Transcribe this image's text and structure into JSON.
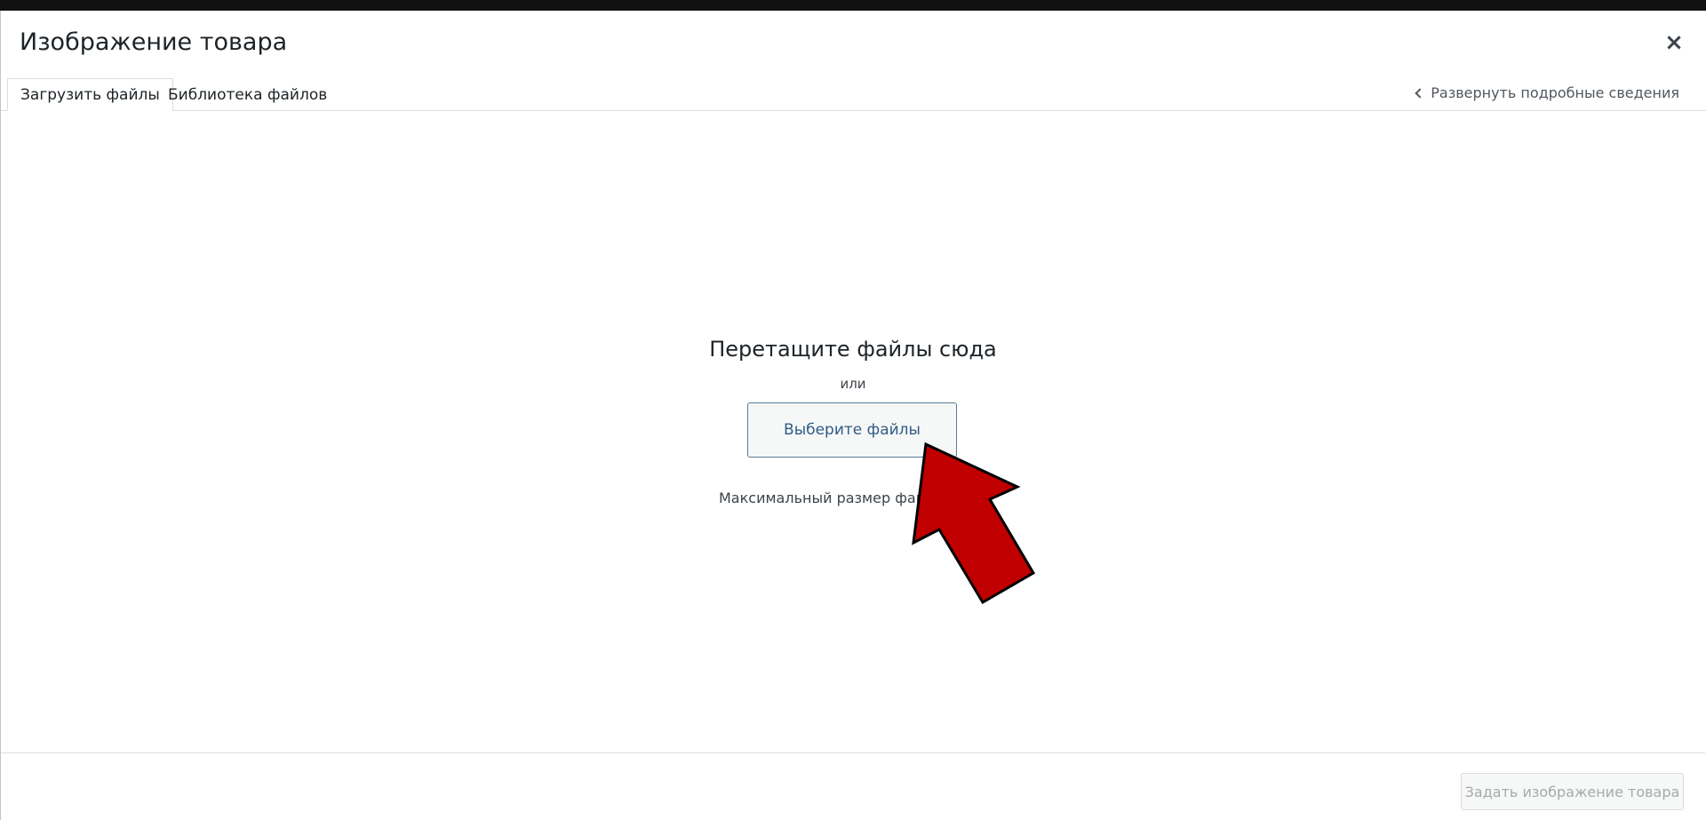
{
  "modal": {
    "title": "Изображение товара",
    "close_label": "×"
  },
  "tabs": [
    {
      "label": "Загрузить файлы",
      "active": true
    },
    {
      "label": "Библиотека файлов",
      "active": false
    }
  ],
  "expand_details": "Развернуть подробные сведения",
  "uploader": {
    "drop_title": "Перетащите файлы сюда",
    "or_text": "или",
    "select_button": "Выберите файлы",
    "max_size_text": "Максимальный размер файла"
  },
  "footer": {
    "set_image_button": "Задать изображение товара"
  },
  "annotation": {
    "arrow_color": "#c00000"
  }
}
